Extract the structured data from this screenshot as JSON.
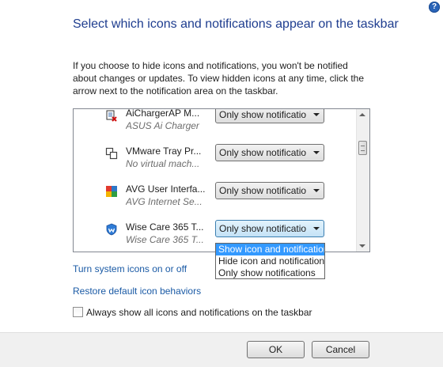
{
  "help": {
    "label": "?"
  },
  "title": "Select which icons and notifications appear on the taskbar",
  "description": "If you choose to hide icons and notifications, you won't be notified about changes or updates. To view hidden icons at any time, click the arrow next to the notification area on the taskbar.",
  "list": {
    "rows": [
      {
        "name": "AiChargerAP M...",
        "subtitle": "ASUS Ai Charger",
        "behavior": "Only show notificatio"
      },
      {
        "name": "VMware Tray Pr...",
        "subtitle": "No virtual mach...",
        "behavior": "Only show notificatio"
      },
      {
        "name": "AVG User Interfa...",
        "subtitle": "AVG Internet Se...",
        "behavior": "Only show notificatio"
      },
      {
        "name": "Wise Care 365 T...",
        "subtitle": "Wise Care 365 T...",
        "behavior": "Only show notificatio"
      }
    ],
    "dropdown_options": [
      "Show icon and notifications",
      "Hide icon and notifications",
      "Only show notifications"
    ],
    "dropdown_selected_index": 0
  },
  "links": {
    "system_icons": "Turn system icons on or off",
    "restore": "Restore default icon behaviors"
  },
  "always_show": {
    "label": "Always show all icons and notifications on the taskbar",
    "checked": false
  },
  "buttons": {
    "ok": "OK",
    "cancel": "Cancel"
  },
  "colors": {
    "title": "#1e3d8f",
    "link": "#1a5aa5",
    "selection": "#3399ff"
  }
}
